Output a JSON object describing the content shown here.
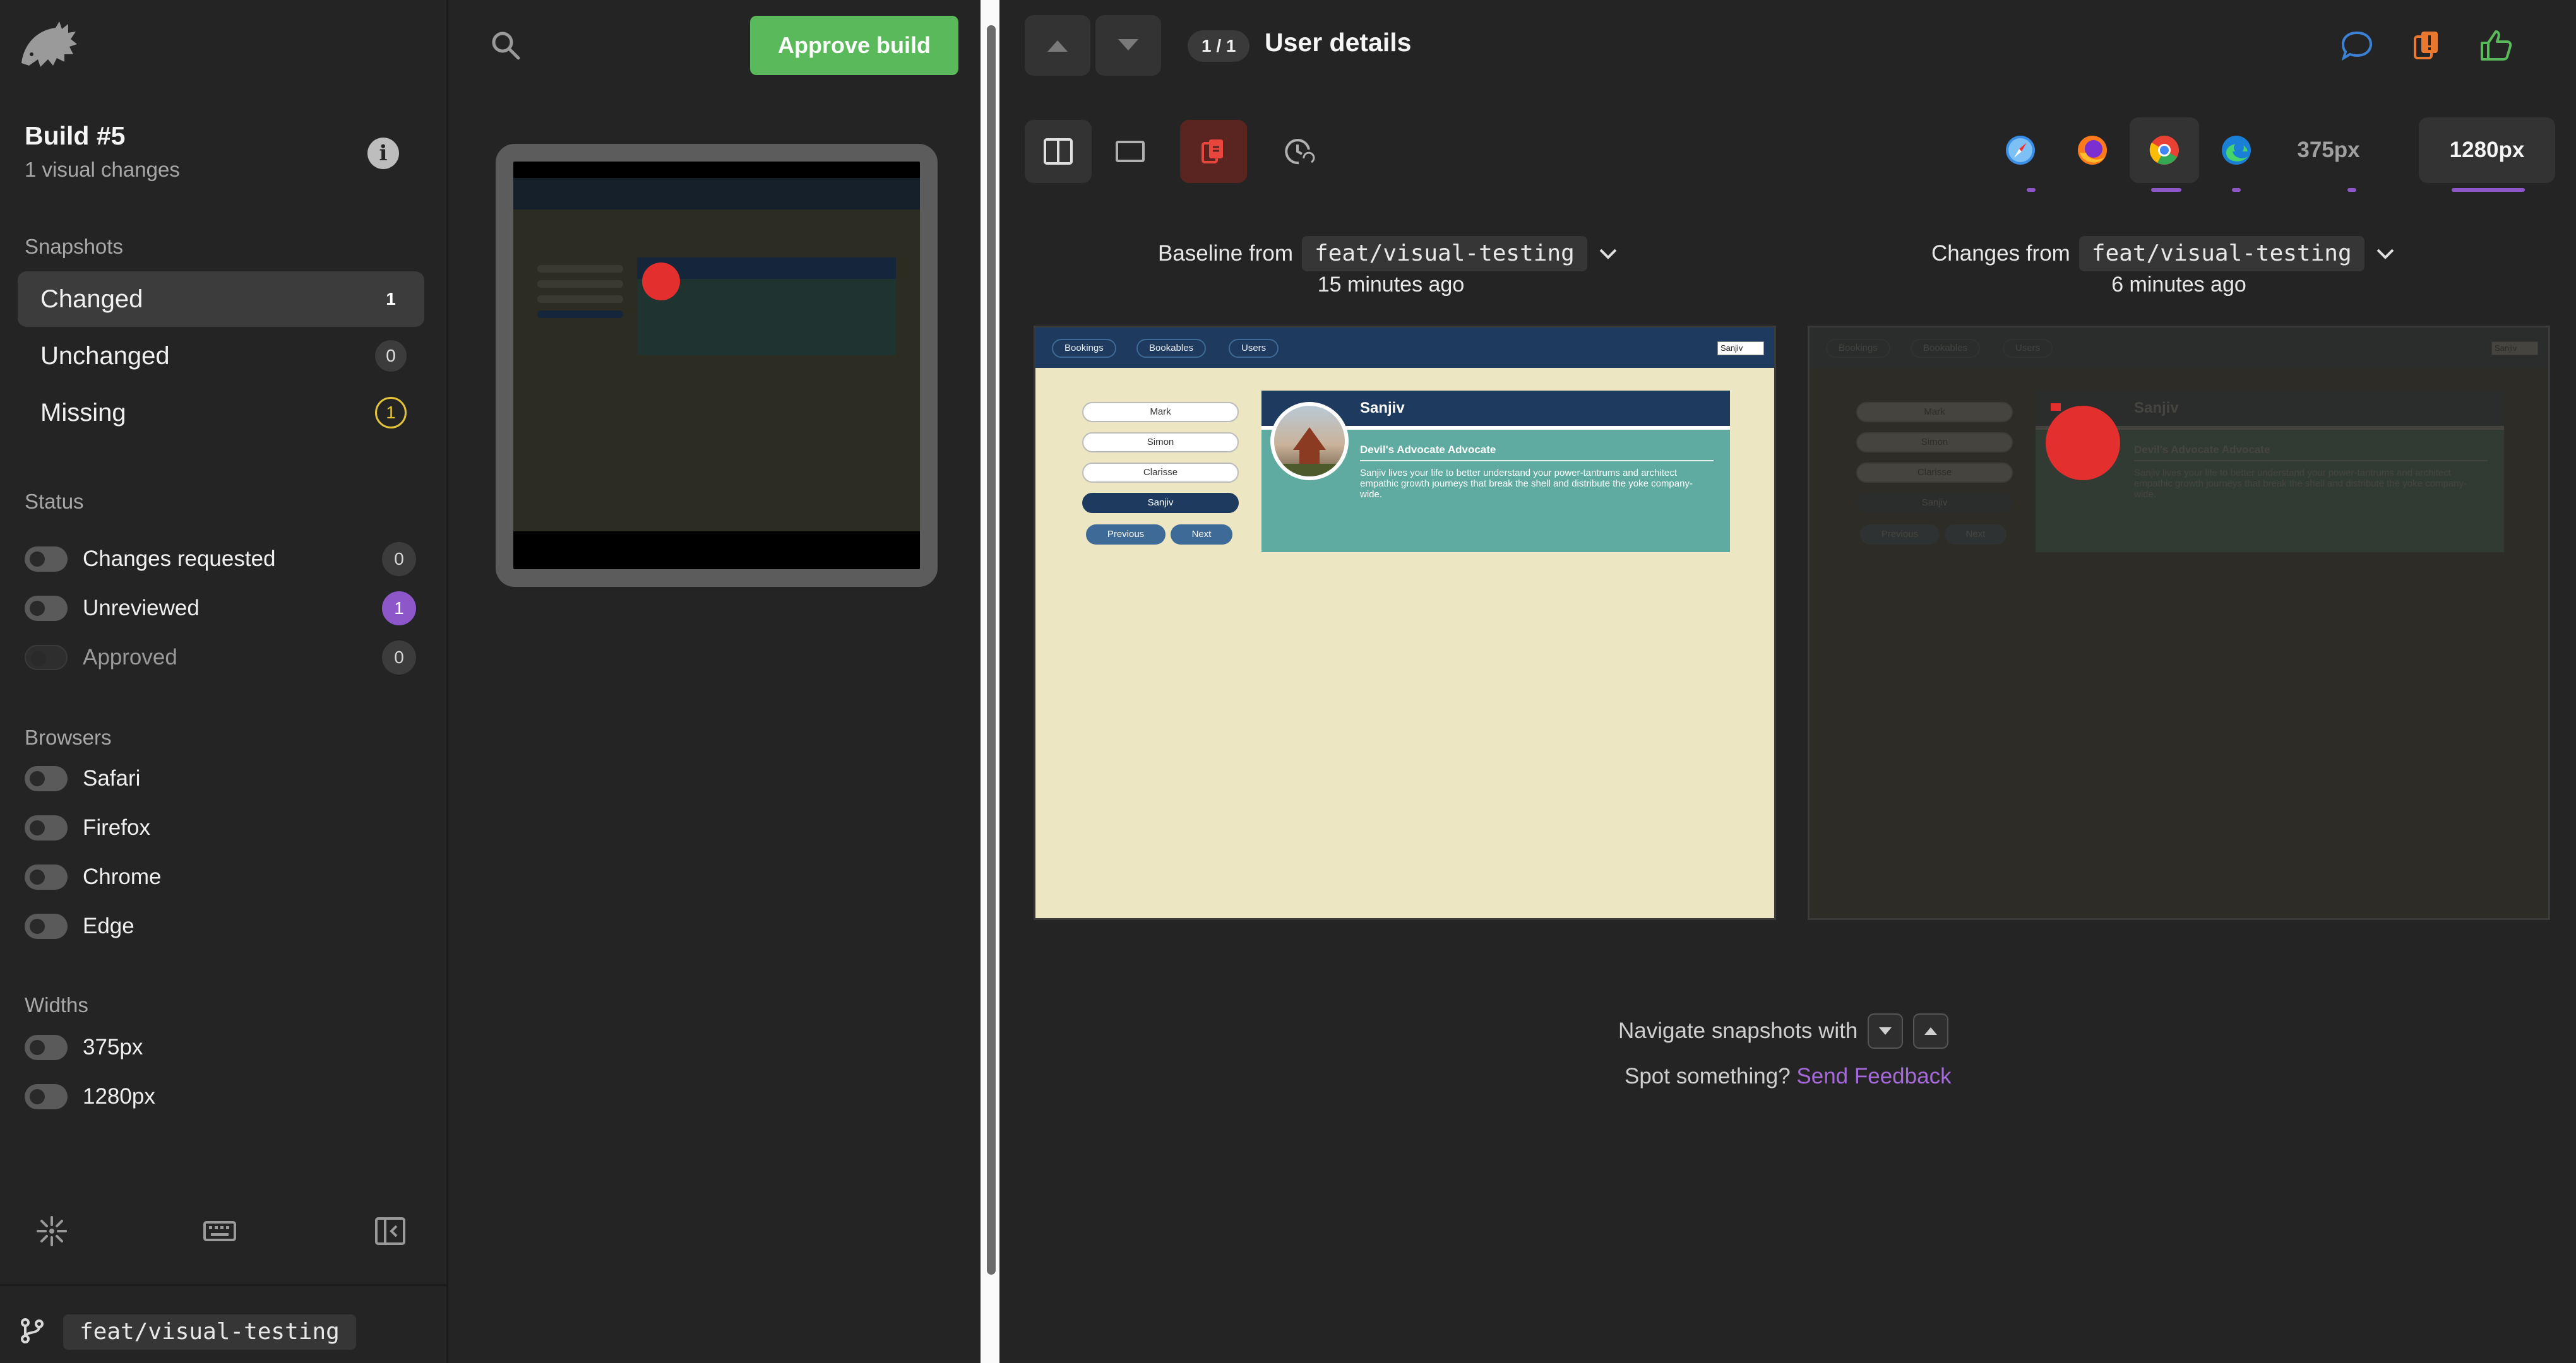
{
  "sidebar": {
    "logo_icon": "hedgehog-logo-icon",
    "build_title": "Build #5",
    "build_subtitle": "1 visual changes",
    "snapshots_label": "Snapshots",
    "snapshots": [
      {
        "label": "Changed",
        "count": "1"
      },
      {
        "label": "Unchanged",
        "count": "0"
      },
      {
        "label": "Missing",
        "count": "1"
      }
    ],
    "status_label": "Status",
    "status": [
      {
        "label": "Changes requested",
        "count": "0"
      },
      {
        "label": "Unreviewed",
        "count": "1"
      },
      {
        "label": "Approved",
        "count": "0"
      }
    ],
    "browsers_label": "Browsers",
    "browsers": [
      "Safari",
      "Firefox",
      "Chrome",
      "Edge"
    ],
    "widths_label": "Widths",
    "widths": [
      "375px",
      "1280px"
    ],
    "branch": "feat/visual-testing"
  },
  "middle": {
    "approve_label": "Approve build"
  },
  "viewer": {
    "counter": "1 / 1",
    "title": "User details",
    "widths": [
      "375px",
      "1280px"
    ],
    "baseline_prefix": "Baseline from",
    "baseline_branch": "feat/visual-testing",
    "baseline_time": "15 minutes ago",
    "changes_prefix": "Changes from",
    "changes_branch": "feat/visual-testing",
    "changes_time": "6 minutes ago",
    "nav_hint": "Navigate snapshots with",
    "feedback_prefix": "Spot something?",
    "feedback_link": "Send Feedback",
    "accent_color": "#8e57c9",
    "approve_color": "#5ab95a"
  },
  "snapshot_app": {
    "nav": [
      "Bookings",
      "Bookables",
      "Users"
    ],
    "user_select": "Sanjiv",
    "users": [
      "Mark",
      "Simon",
      "Clarisse",
      "Sanjiv"
    ],
    "prev": "Previous",
    "next": "Next",
    "name": "Sanjiv",
    "role": "Devil's Advocate Advocate",
    "bio": "Sanjiv lives your life to better understand your power-tantrums and architect empathic growth journeys that break the shell and distribute the yoke company-wide."
  }
}
